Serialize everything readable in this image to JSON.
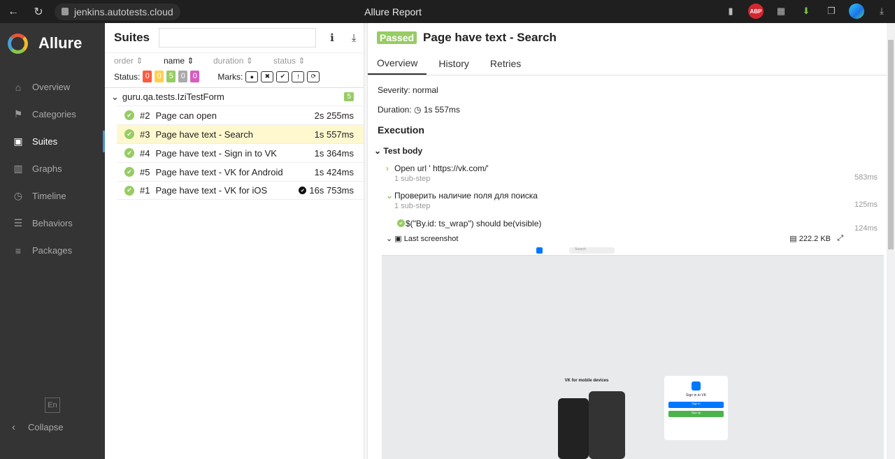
{
  "browser": {
    "url": "jenkins.autotests.cloud",
    "title": "Allure Report",
    "abp": "ABP"
  },
  "sidebar": {
    "brand": "Allure",
    "items": [
      {
        "label": "Overview",
        "icon": "home-icon"
      },
      {
        "label": "Categories",
        "icon": "flag-icon"
      },
      {
        "label": "Suites",
        "icon": "briefcase-icon"
      },
      {
        "label": "Graphs",
        "icon": "bar-chart-icon"
      },
      {
        "label": "Timeline",
        "icon": "clock-icon"
      },
      {
        "label": "Behaviors",
        "icon": "list-icon"
      },
      {
        "label": "Packages",
        "icon": "align-left-icon"
      }
    ],
    "lang": "En",
    "collapse": "Collapse"
  },
  "suites": {
    "title": "Suites",
    "columns": [
      "order",
      "name",
      "duration",
      "status"
    ],
    "status_label": "Status:",
    "status_counts": [
      {
        "value": "0",
        "color": "#fd5a3e"
      },
      {
        "value": "0",
        "color": "#ffd050"
      },
      {
        "value": "5",
        "color": "#97cc64"
      },
      {
        "value": "0",
        "color": "#aaaaaa"
      },
      {
        "value": "0",
        "color": "#d35ebe"
      }
    ],
    "marks_label": "Marks:",
    "group": {
      "name": "guru.qa.tests.IziTestForm",
      "count": "5"
    },
    "rows": [
      {
        "num": "#2",
        "name": "Page can open",
        "dur": "2s 255ms"
      },
      {
        "num": "#3",
        "name": "Page have text - Search",
        "dur": "1s 557ms"
      },
      {
        "num": "#4",
        "name": "Page have text - Sign in to VK",
        "dur": "1s 364ms"
      },
      {
        "num": "#5",
        "name": "Page have text - VK for Android",
        "dur": "1s 424ms"
      },
      {
        "num": "#1",
        "name": "Page have text - VK for iOS",
        "dur": "16s 753ms"
      }
    ]
  },
  "detail": {
    "status": "Passed",
    "title": "Page have text - Search",
    "tabs": [
      "Overview",
      "History",
      "Retries"
    ],
    "severity": "Severity: normal",
    "duration_label": "Duration:",
    "duration": "1s 557ms",
    "execution": "Execution",
    "test_body": "Test body",
    "steps": [
      {
        "name": "Open url ' https://vk.com/'",
        "sub": "1 sub-step",
        "time": "583ms"
      },
      {
        "name": "Проверить наличие поля для поиска",
        "sub": "1 sub-step",
        "time": "125ms"
      }
    ],
    "assert": "$(\"By.id: ts_wrap\") should be(visible)",
    "assert_time": "124ms",
    "attachment": "Last screenshot",
    "attachment_size": "222.2 KB",
    "shot": {
      "search": "Search",
      "heading": "VK for mobile devices",
      "card_title": "Sign in to VK",
      "sign_in": "Sign in",
      "signup": "Sign up"
    }
  }
}
